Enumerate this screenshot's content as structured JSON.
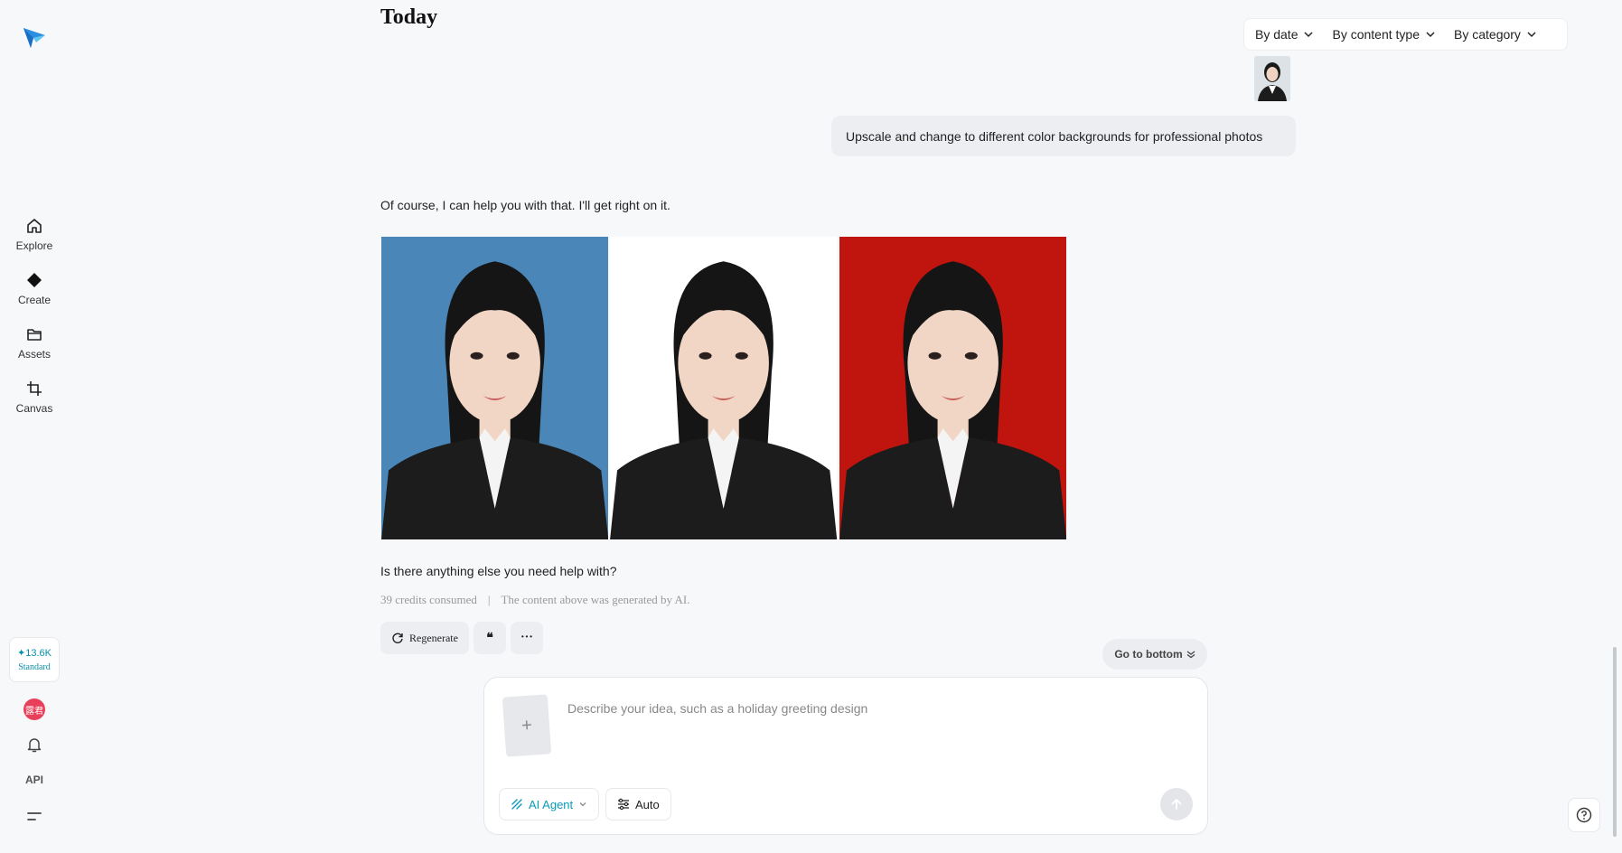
{
  "sidebar": {
    "items": [
      {
        "label": "Explore",
        "icon": "home-icon"
      },
      {
        "label": "Create",
        "icon": "diamond-icon"
      },
      {
        "label": "Assets",
        "icon": "folder-icon"
      },
      {
        "label": "Canvas",
        "icon": "crop-icon"
      }
    ],
    "credits": {
      "amount": "13.6K",
      "tier": "Standard"
    },
    "avatar_text": "露君",
    "api_label": "API"
  },
  "header": {
    "title": "Today",
    "filters": [
      {
        "label": "By date"
      },
      {
        "label": "By content type"
      },
      {
        "label": "By category"
      }
    ]
  },
  "conversation": {
    "user_message": "Upscale and change to different color backgrounds for professional photos",
    "ai_intro": "Of course, I can help you with that. I'll get right on it.",
    "images": [
      {
        "background": "#4a86b8"
      },
      {
        "background": "#ffffff"
      },
      {
        "background": "#c0140f"
      }
    ],
    "ai_followup": "Is there anything else you need help with?",
    "credits_consumed": "39 credits consumed",
    "separator": "|",
    "ai_notice": "The content above was generated by AI.",
    "actions": {
      "regenerate": "Regenerate",
      "quote": "❝",
      "more": "···"
    }
  },
  "go_to_bottom": "Go to bottom",
  "composer": {
    "placeholder": "Describe your idea, such as a holiday greeting design",
    "value": "",
    "add_symbol": "+",
    "mode_label": "AI Agent",
    "setting_label": "Auto"
  },
  "colors": {
    "accent": "#0a9ab8",
    "avatar": "#e8405a"
  }
}
